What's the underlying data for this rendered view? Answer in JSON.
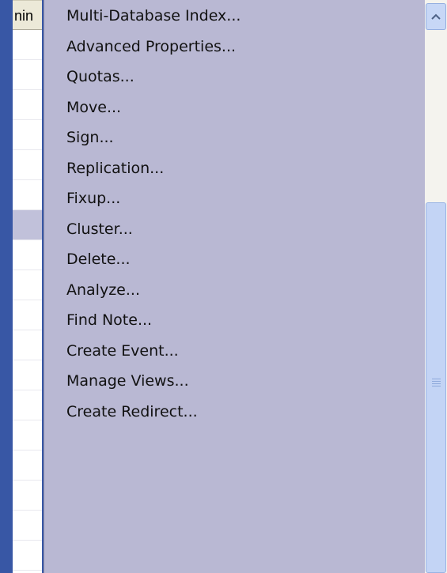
{
  "background_list": {
    "header_text": "nin",
    "selected_row_index": 6
  },
  "context_menu": {
    "items": [
      {
        "label": "Multi-Database Index..."
      },
      {
        "label": "Advanced Properties..."
      },
      {
        "label": "Quotas..."
      },
      {
        "label": "Move..."
      },
      {
        "label": "Sign..."
      },
      {
        "label": "Replication..."
      },
      {
        "label": "Fixup..."
      },
      {
        "label": "Cluster..."
      },
      {
        "label": "Delete..."
      },
      {
        "label": "Analyze..."
      },
      {
        "label": "Find Note..."
      },
      {
        "label": "Create Event..."
      },
      {
        "label": "Manage Views..."
      },
      {
        "label": "Create Redirect..."
      }
    ]
  },
  "scrollbar": {
    "up_icon": "chevron-up-icon",
    "grip_icon": "scroll-grip-icon"
  },
  "colors": {
    "desktop": "#3857a5",
    "menu_bg": "#b9b8d3",
    "selected_row": "#c1c1da"
  }
}
